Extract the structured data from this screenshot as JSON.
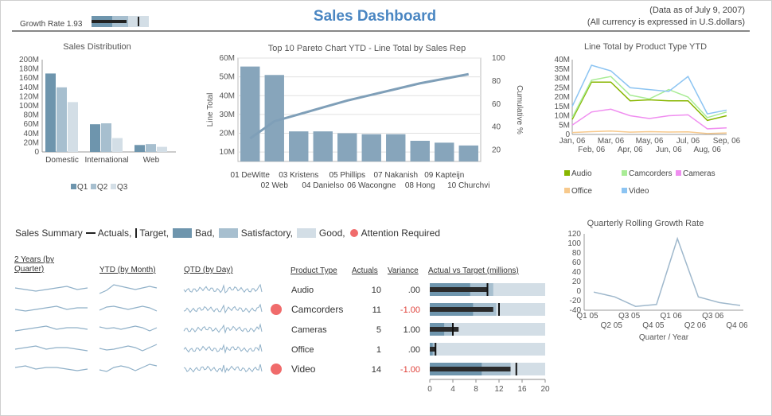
{
  "header": {
    "growth_rate_label": "Growth Rate 1.93",
    "growth_rate_value": 1.93,
    "title": "Sales Dashboard",
    "data_date": "(Data as of July 9, 2007)",
    "currency_note": "(All currency is expressed in U.S.dollars)"
  },
  "colors": {
    "title": "#4a86c2",
    "bar_dark": "#6e95ad",
    "bar_mid": "#a7bfcf",
    "bar_light": "#d3dee6",
    "pareto_bar": "#87a5bb",
    "pareto_line": "#7f9fb8",
    "attention": "#f06b6b",
    "variance_negative": "#e0413a",
    "audio": "#88b600",
    "camcorders": "#a9ec96",
    "cameras": "#f08ef0",
    "office": "#f7c98c",
    "video": "#8cc4f2"
  },
  "chart_data": [
    {
      "type": "bar",
      "title": "Sales Distribution",
      "categories": [
        "Domestic",
        "International",
        "Web"
      ],
      "series": [
        {
          "name": "Q1",
          "values": [
            170,
            60,
            15
          ]
        },
        {
          "name": "Q2",
          "values": [
            140,
            62,
            17
          ]
        },
        {
          "name": "Q3",
          "values": [
            108,
            30,
            11
          ]
        }
      ],
      "yticks": [
        "0",
        "20M",
        "40M",
        "60M",
        "80M",
        "100M",
        "120M",
        "140M",
        "160M",
        "180M",
        "200M"
      ],
      "ylim": [
        0,
        200
      ],
      "legend": "bottom"
    },
    {
      "type": "bar",
      "title": "Top 10 Pareto Chart YTD - Line Total by Sales Rep",
      "categories": [
        "01 DeWitte",
        "02 Web",
        "03 Kristens",
        "04 Danielso",
        "05 Phillips",
        "06 Wacongne",
        "07 Nakanish",
        "08 Hong",
        "09 Kapteijn",
        "10 Churchvi"
      ],
      "values": [
        55.5,
        51,
        21,
        21,
        20,
        19.5,
        19.5,
        16,
        15,
        13.5
      ],
      "cumulative": [
        30,
        45,
        51,
        57,
        63,
        68,
        73,
        78,
        82,
        86
      ],
      "ylabel": "Line Total",
      "y2label": "Cumulative %",
      "yticks": [
        "10M",
        "20M",
        "30M",
        "40M",
        "50M",
        "60M"
      ],
      "y2ticks": [
        "20",
        "40",
        "60",
        "80",
        "100"
      ],
      "ylim": [
        5,
        60
      ],
      "y2lim": [
        10,
        100
      ]
    },
    {
      "type": "line",
      "title": "Line Total by Product Type YTD",
      "x": [
        "Jan, 06",
        "Feb, 06",
        "Mar, 06",
        "Apr, 06",
        "May, 06",
        "Jun, 06",
        "Jul, 06",
        "Aug, 06",
        "Sep, 06"
      ],
      "xticks_top": [
        "Jan, 06",
        "Mar, 06",
        "May, 06",
        "Jul, 06",
        "Sep, 06"
      ],
      "xticks_bottom": [
        "Feb, 06",
        "Apr, 06",
        "Jun, 06",
        "Aug, 06"
      ],
      "yticks": [
        "0",
        "5M",
        "10M",
        "15M",
        "20M",
        "25M",
        "30M",
        "35M",
        "40M"
      ],
      "ylim": [
        0,
        40
      ],
      "series": [
        {
          "name": "Audio",
          "values": [
            8,
            28,
            28,
            18,
            18.5,
            18,
            18,
            7.5,
            10
          ]
        },
        {
          "name": "Camcorders",
          "values": [
            9,
            29,
            31,
            21,
            19,
            24,
            20,
            9,
            12
          ]
        },
        {
          "name": "Cameras",
          "values": [
            5,
            12,
            13.5,
            10,
            8.5,
            10,
            10.5,
            3,
            3.5
          ]
        },
        {
          "name": "Office",
          "values": [
            1,
            1.5,
            1.8,
            1.2,
            1.5,
            1.3,
            1.4,
            0.5,
            0.8
          ]
        },
        {
          "name": "Video",
          "values": [
            15,
            37,
            34,
            25,
            24,
            23,
            31,
            11,
            13
          ]
        }
      ],
      "legend": "bottom"
    },
    {
      "type": "line",
      "title": "Quarterly Rolling Growth Rate",
      "x": [
        "Q1 05",
        "Q2 05",
        "Q3 05",
        "Q4 05",
        "Q1 06",
        "Q2 06",
        "Q3 06",
        "Q4 06"
      ],
      "values": [
        -2,
        -12,
        -32,
        -28,
        110,
        -12,
        -24,
        -30
      ],
      "xticks_top": [
        "Q1 05",
        "Q3 05",
        "Q1 06",
        "Q3 06"
      ],
      "xticks_bottom": [
        "Q2 05",
        "Q4 05",
        "Q2 06",
        "Q4 06"
      ],
      "yticks": [
        "-40",
        "-20",
        "0",
        "20",
        "40",
        "60",
        "80",
        "100",
        "120"
      ],
      "ylim": [
        -40,
        120
      ],
      "xlabel": "Quarter / Year"
    },
    {
      "type": "table",
      "title": "Sales Summary",
      "columns": [
        "Product Type",
        "Actuals",
        "Variance",
        "Actual vs Target (millions)"
      ],
      "rows": [
        {
          "product": "Audio",
          "actuals": "10",
          "variance": ".00",
          "actual": 10,
          "target": 10,
          "bad": 7,
          "satisfactory": 11,
          "attention": false
        },
        {
          "product": "Camcorders",
          "actuals": "11",
          "variance": "-1.00",
          "actual": 11,
          "target": 12,
          "bad": 7.5,
          "satisfactory": 11.5,
          "attention": true
        },
        {
          "product": "Cameras",
          "actuals": "5",
          "variance": "1.00",
          "actual": 5,
          "target": 4,
          "bad": 2.5,
          "satisfactory": 4,
          "attention": false
        },
        {
          "product": "Office",
          "actuals": "1",
          "variance": ".00",
          "actual": 1,
          "target": 1,
          "bad": 0.5,
          "satisfactory": 1,
          "attention": false
        },
        {
          "product": "Video",
          "actuals": "14",
          "variance": "-1.00",
          "actual": 14,
          "target": 15,
          "bad": 9,
          "satisfactory": 14,
          "attention": true
        }
      ],
      "bullet_xticks": [
        "0",
        "4",
        "8",
        "12",
        "16",
        "20"
      ],
      "bullet_xlim": [
        0,
        20
      ]
    }
  ],
  "summary": {
    "title_text": "Sales Summary",
    "legend": {
      "actuals": "Actuals,",
      "target": "Target,",
      "bad": "Bad,",
      "satisfactory": "Satisfactory,",
      "good": "Good,",
      "attention": "Attention Required"
    },
    "spark_headers": {
      "two_years": "2 Years (by Quarter)",
      "ytd": "YTD (by Month)",
      "qtd": "QTD (by Day)"
    }
  }
}
